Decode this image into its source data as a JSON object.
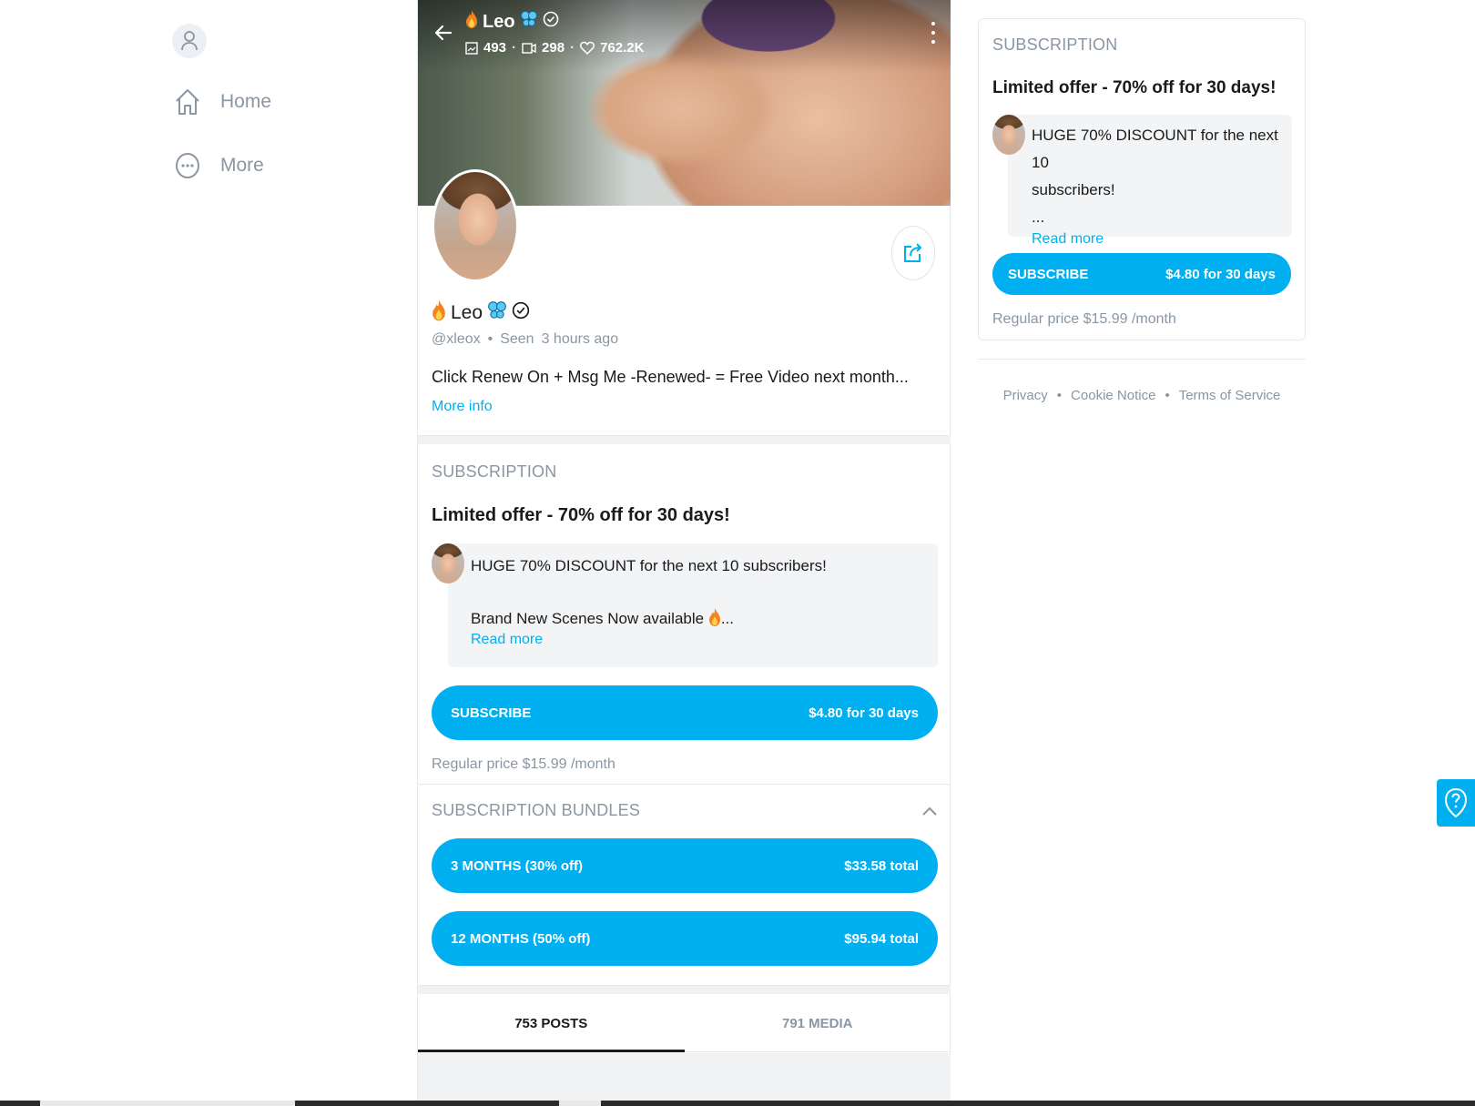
{
  "nav": {
    "items": [
      {
        "label": "Home",
        "icon": "home-icon"
      },
      {
        "label": "More",
        "icon": "more-icon"
      }
    ]
  },
  "cover": {
    "name": "Leo",
    "stats": {
      "images": "493",
      "videos": "298",
      "likes": "762.2K"
    }
  },
  "profile": {
    "name": "Leo",
    "handle": "@xleox",
    "seen_prefix": "Seen",
    "seen_time": "3 hours ago",
    "bio": "Click Renew On + Msg Me -Renewed- = Free Video next month...",
    "more_info": "More info"
  },
  "subscription": {
    "label": "SUBSCRIPTION",
    "offer_title": "Limited offer - 70% off for 30 days!",
    "promo_line1": "HUGE 70% DISCOUNT for the next 10 subscribers!",
    "promo_line2": "Brand New Scenes Now available",
    "promo_ellipsis": "...",
    "read_more": "Read more",
    "button_label": "SUBSCRIBE",
    "button_price": "$4.80 for 30 days",
    "regular_price": "Regular price $15.99 /month"
  },
  "bundles": {
    "label": "SUBSCRIPTION BUNDLES",
    "items": [
      {
        "label": "3 MONTHS (30% off)",
        "price": "$33.58 total"
      },
      {
        "label": "12 MONTHS (50% off)",
        "price": "$95.94 total"
      }
    ]
  },
  "tabs": [
    {
      "label": "753 POSTS",
      "active": true
    },
    {
      "label": "791 MEDIA",
      "active": false
    }
  ],
  "sidebar_subscription": {
    "label": "SUBSCRIPTION",
    "offer_title": "Limited offer - 70% off for 30 days!",
    "promo_line1": "HUGE 70% DISCOUNT for the next 10",
    "promo_line2": "subscribers!",
    "promo_ellipsis": "...",
    "read_more": "Read more",
    "button_label": "SUBSCRIBE",
    "button_price": "$4.80 for 30 days",
    "regular_price": "Regular price $15.99 /month"
  },
  "footer": {
    "privacy": "Privacy",
    "cookie": "Cookie Notice",
    "terms": "Terms of Service"
  },
  "colors": {
    "accent": "#00aff0",
    "muted": "#8a96a3",
    "text": "#1a1a1a"
  }
}
